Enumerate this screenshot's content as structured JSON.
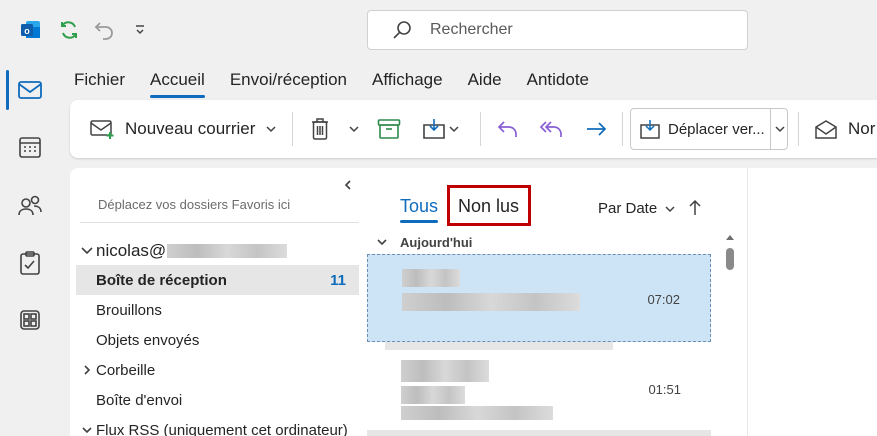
{
  "titlebar": {
    "icons": [
      "outlook-logo",
      "sync-icon",
      "undo-icon",
      "customize-dropdown-icon"
    ],
    "search_placeholder": "Rechercher"
  },
  "rail": {
    "items": [
      "mail-icon",
      "calendar-icon",
      "people-icon",
      "todo-icon",
      "apps-icon"
    ],
    "active": "mail-icon"
  },
  "menu": {
    "tabs": [
      "Fichier",
      "Accueil",
      "Envoi/réception",
      "Affichage",
      "Aide",
      "Antidote"
    ],
    "active_tab": "Accueil"
  },
  "ribbon": {
    "new_mail_label": "Nouveau courrier",
    "move_label": "Déplacer ver...",
    "last_label": "Nor"
  },
  "folders": {
    "favorites_hint": "Déplacez vos dossiers Favoris ici",
    "account_prefix": "nicolas@",
    "items": [
      {
        "label": "Boîte de réception",
        "count": "11",
        "selected": true
      },
      {
        "label": "Brouillons"
      },
      {
        "label": "Objets envoyés"
      },
      {
        "label": "Corbeille",
        "collapsed": true
      },
      {
        "label": "Boîte d'envoi"
      },
      {
        "label": "Flux RSS (uniquement cet ordinateur)",
        "expanded": true
      }
    ]
  },
  "message_list": {
    "tab_all": "Tous",
    "tab_unread": "Non lus",
    "sort_label": "Par Date",
    "group_label": "Aujourd'hui",
    "messages": [
      {
        "time": "07:02",
        "selected": true
      },
      {
        "time": "01:51",
        "selected": false
      }
    ]
  },
  "colors": {
    "accent": "#0f6cbd",
    "selection": "#cce4f6",
    "highlight_box": "#c00000"
  }
}
